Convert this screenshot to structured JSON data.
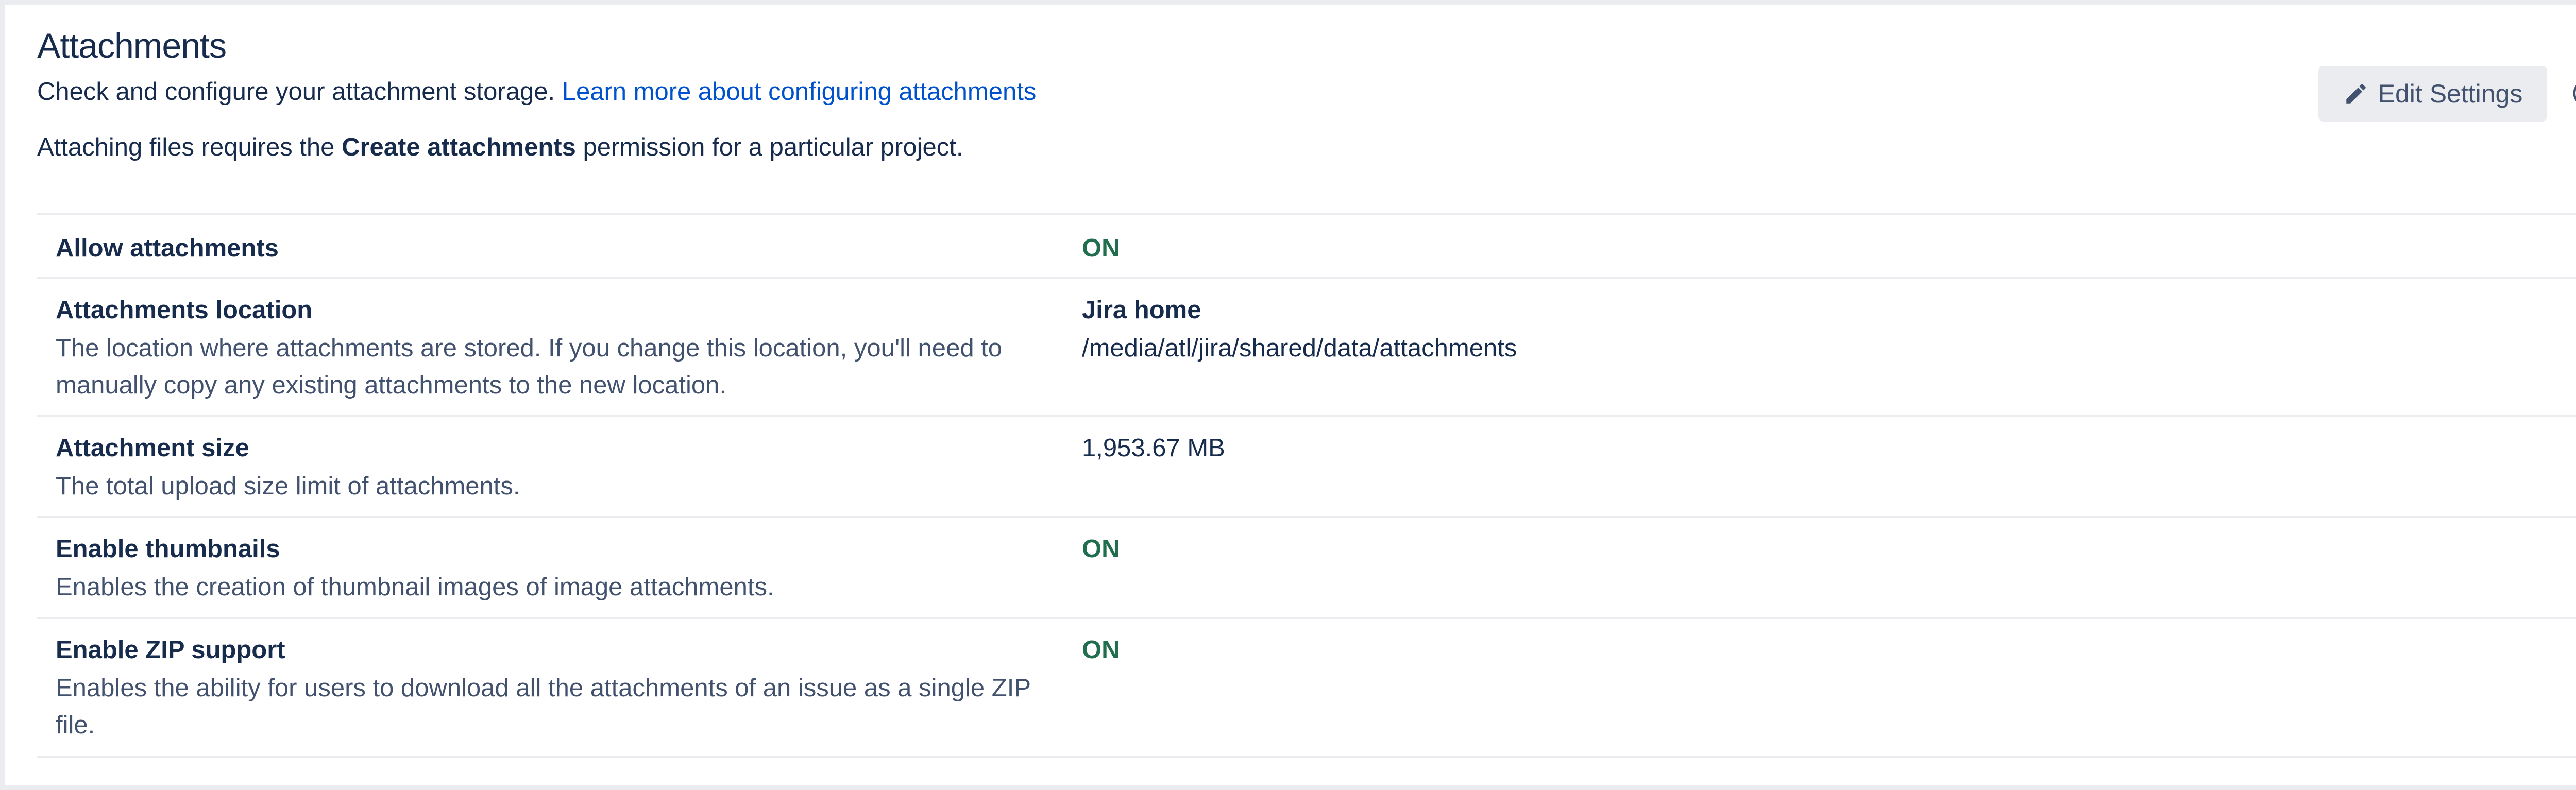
{
  "header": {
    "title": "Attachments",
    "description": "Check and configure your attachment storage.",
    "learn_more_link": "Learn more about configuring attachments",
    "permission_prefix": "Attaching files requires the",
    "permission_name": "Create attachments",
    "permission_suffix": "permission for a particular project."
  },
  "toolbar": {
    "edit_settings_label": "Edit Settings",
    "edit_icon": "pencil-icon",
    "help_icon": "question-circle-icon"
  },
  "settings": [
    {
      "label": "Allow attachments",
      "help": "",
      "value": "ON"
    },
    {
      "label": "Attachments location",
      "help": "The location where attachments are stored. If you change this location, you'll need to manually copy any existing attachments to the new location.",
      "value": "Jira home",
      "value_detail": "/media/atl/jira/shared/data/attachments"
    },
    {
      "label": "Attachment size",
      "help": "The total upload size limit of attachments.",
      "value": "1,953.67 MB"
    },
    {
      "label": "Enable thumbnails",
      "help": "Enables the creation of thumbnail images of image attachments.",
      "value": "ON"
    },
    {
      "label": "Enable ZIP support",
      "help": "Enables the ability for users to download all the attachments of an issue as a single ZIP file.",
      "value": "ON"
    }
  ],
  "colors": {
    "on_status": "#216e4e",
    "link": "#0052cc",
    "text": "#172b4d",
    "border": "#ebecf0"
  }
}
